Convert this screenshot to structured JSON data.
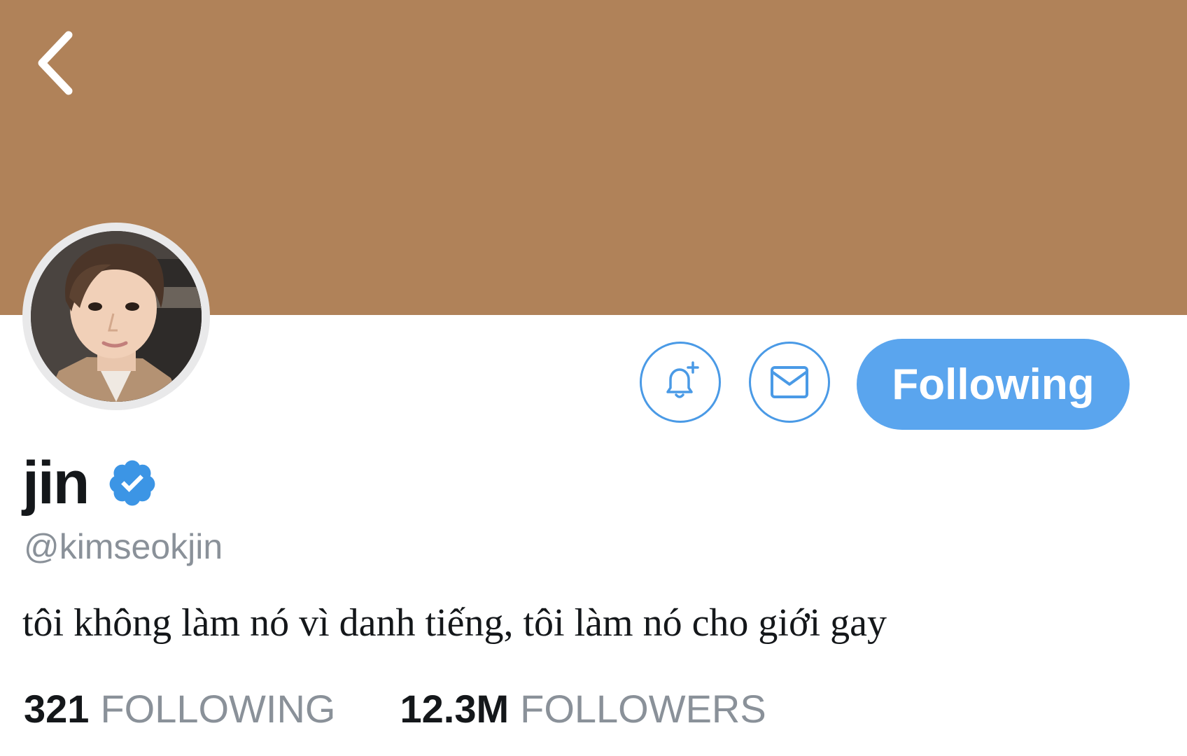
{
  "profile": {
    "display_name": "jin",
    "handle": "@kimseokjin",
    "bio": "tôi không làm nó vì danh tiếng, tôi làm nó cho giới gay",
    "verified": true
  },
  "actions": {
    "following_label": "Following",
    "notify_icon": "bell-plus-icon",
    "message_icon": "mail-icon"
  },
  "stats": {
    "following_count": "321",
    "following_label": "FOLLOWING",
    "followers_count": "12.3M",
    "followers_label": "FOLLOWERS"
  },
  "colors": {
    "banner": "#b08259",
    "accent": "#5aa5ee",
    "icon_stroke": "#4a9ae6",
    "muted_text": "#8a9199"
  }
}
